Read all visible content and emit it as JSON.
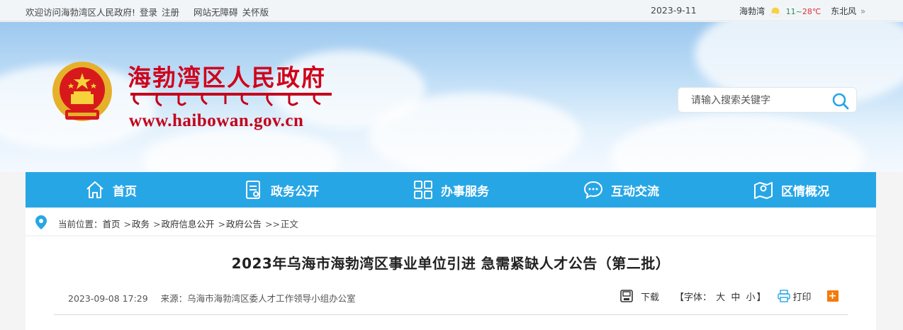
{
  "topbar": {
    "welcome": "欢迎访问海勃湾区人民政府!",
    "login": "登录",
    "register": "注册",
    "accessible": "网站无障碍",
    "care_mode": "关怀版",
    "date": "2023-9-11",
    "weather_city": "海勃湾",
    "temp_low": "11~",
    "temp_high": "28℃",
    "wind": "东北风",
    "more": "»"
  },
  "header": {
    "site_title": "海勃湾区人民政府",
    "site_url": "www.haibowan.gov.cn",
    "search_placeholder": "请输入搜索关键字"
  },
  "nav": {
    "items": [
      {
        "label": "首页",
        "icon": "home-icon"
      },
      {
        "label": "政务公开",
        "icon": "document-icon"
      },
      {
        "label": "办事服务",
        "icon": "grid-icon"
      },
      {
        "label": "互动交流",
        "icon": "chat-icon"
      },
      {
        "label": "区情概况",
        "icon": "map-icon"
      }
    ]
  },
  "breadcrumb": {
    "prefix": "当前位置：",
    "items": [
      "首页",
      "政务",
      "政府信息公开",
      "政府公告"
    ],
    "current": "正文"
  },
  "article": {
    "title": "2023年乌海市海勃湾区事业单位引进 急需紧缺人才公告（第二批）",
    "datetime": "2023-09-08 17:29",
    "source_label": "来源：",
    "source": "乌海市海勃湾区委人才工作领导小组办公室",
    "download": "下载",
    "font_label": "【字体：",
    "font_large": "大",
    "font_medium": "中",
    "font_small": "小",
    "font_end": "】",
    "print": "打印",
    "plus": "+"
  },
  "colors": {
    "nav_bg": "#27a6e6",
    "title_red": "#d0021b",
    "share_orange": "#f37b0c"
  }
}
